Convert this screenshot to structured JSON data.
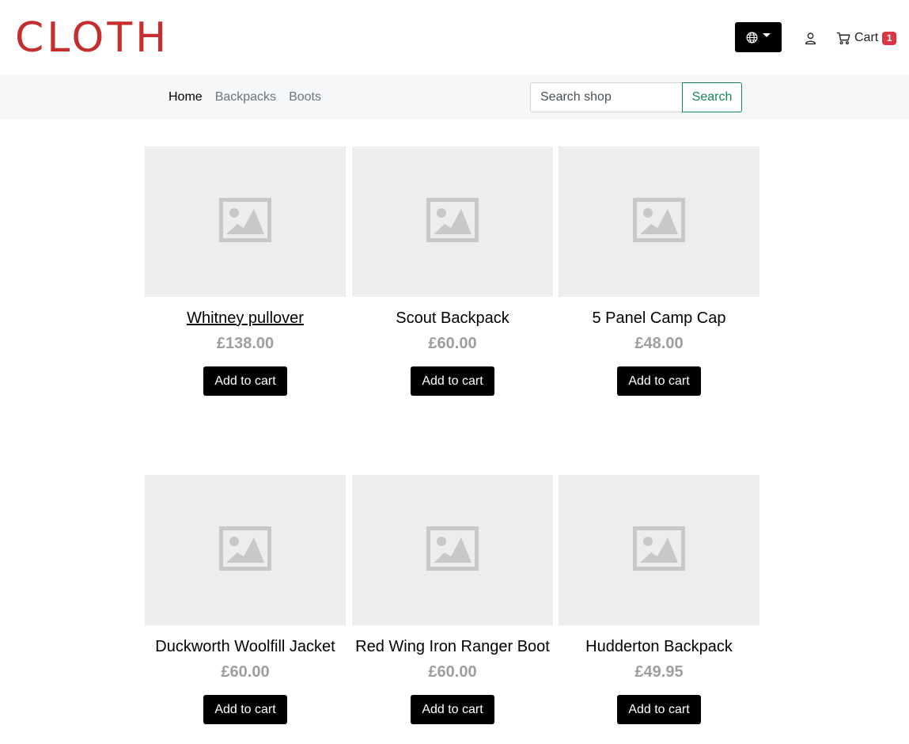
{
  "brand": {
    "logo_text": "CLOTH",
    "logo_color": "#c62d2d"
  },
  "header": {
    "language_button_icon": "globe-icon",
    "account_icon": "user-icon",
    "cart": {
      "icon": "cart-icon",
      "label": "Cart",
      "count": "1"
    }
  },
  "nav": {
    "links": [
      {
        "label": "Home",
        "active": true
      },
      {
        "label": "Backpacks",
        "active": false
      },
      {
        "label": "Boots",
        "active": false
      }
    ],
    "search": {
      "placeholder": "Search shop",
      "button_label": "Search",
      "button_color": "#198754"
    }
  },
  "products": [
    {
      "name": "Whitney pullover",
      "price": "£138.00",
      "button_label": "Add to cart"
    },
    {
      "name": "Scout Backpack",
      "price": "£60.00",
      "button_label": "Add to cart"
    },
    {
      "name": "5 Panel Camp Cap",
      "price": "£48.00",
      "button_label": "Add to cart"
    },
    {
      "name": "Duckworth Woolfill Jacket",
      "price": "£60.00",
      "button_label": "Add to cart"
    },
    {
      "name": "Red Wing Iron Ranger Boot",
      "price": "£60.00",
      "button_label": "Add to cart"
    },
    {
      "name": "Hudderton Backpack",
      "price": "£49.95",
      "button_label": "Add to cart"
    }
  ]
}
